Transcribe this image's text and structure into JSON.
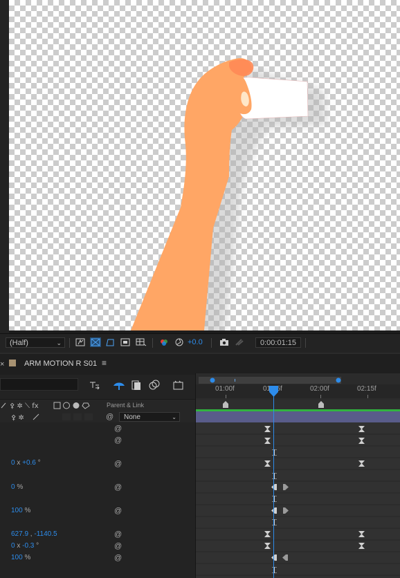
{
  "viewer": {
    "resolution": "(Half)",
    "exposure": "+0.0",
    "timecode": "0:00:01:15"
  },
  "composition": {
    "tab_close": "×",
    "tab_title": "ARM MOTION R S01",
    "tab_menu": "≡",
    "parent_header": "Parent & Link",
    "parent_value": "None"
  },
  "timeline": {
    "ticks": [
      "01:00f",
      "01:15f",
      "02:00f",
      "02:15f"
    ]
  },
  "properties": [
    {
      "value": "0",
      "sep": " x ",
      "value2": "+0.6",
      "unit": " °"
    },
    {
      "value": "0",
      "sep": "",
      "value2": "",
      "unit": " %"
    },
    {
      "value": "100",
      "sep": "",
      "value2": "",
      "unit": " %"
    },
    {
      "value": "627.9",
      "sep": " , ",
      "value2": "-1140.5",
      "unit": ""
    },
    {
      "value": "0",
      "sep": " x ",
      "value2": "-0.3",
      "unit": " °"
    },
    {
      "value": "100",
      "sep": "",
      "value2": "",
      "unit": " %"
    }
  ],
  "colors": {
    "accent": "#2d8ceb",
    "layer_bar": "#595c8a",
    "label_green": "#31b33f",
    "skin": "#ffa665"
  }
}
